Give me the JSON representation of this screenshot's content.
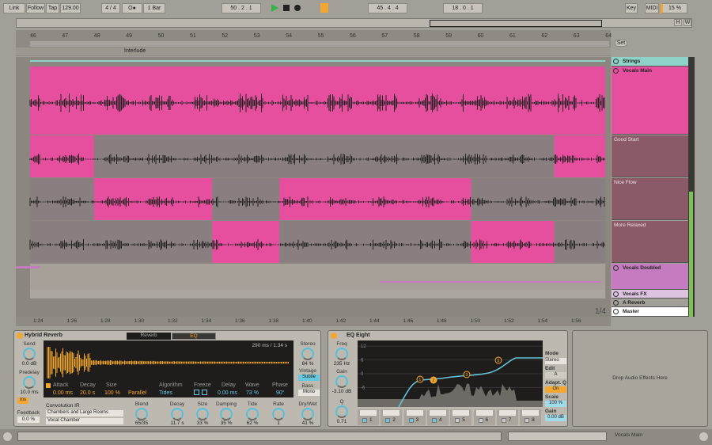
{
  "toolbar": {
    "link": "Link",
    "follow": "Follow",
    "tap": "Tap",
    "tempo": "129.00",
    "signature": "4 / 4",
    "quantize": "1 Bar",
    "position": "50 .  2 .  1",
    "loop_start": "45 .  4 .  4",
    "loop_length": "18 .  0 .  1",
    "key": "Key",
    "midi": "MIDI",
    "cpu": "15 %",
    "metronome": "O●"
  },
  "overview": {
    "h": "H",
    "w": "W"
  },
  "ruler": {
    "bars": [
      "46",
      "47",
      "48",
      "49",
      "50",
      "51",
      "52",
      "53",
      "54",
      "55",
      "56",
      "57",
      "58",
      "59",
      "60",
      "61",
      "62",
      "63",
      "64"
    ],
    "locator": "Interlude",
    "set": "Set"
  },
  "time_ruler": {
    "labels": [
      "1:24",
      "1:26",
      "1:28",
      "1:30",
      "1:32",
      "1:34",
      "1:36",
      "1:38",
      "1:40",
      "1:42",
      "1:44",
      "1:46",
      "1:48",
      "1:50",
      "1:52",
      "1:54",
      "1:56"
    ],
    "zoom": "1/4"
  },
  "tracks": [
    {
      "name": "Strings",
      "color": "#8fd3c8"
    },
    {
      "name": "Vocals Main",
      "color": "#e54f9e"
    },
    {
      "name": "Good Start",
      "color": "#8a5a68"
    },
    {
      "name": "Nice Flow",
      "color": "#8a5a68"
    },
    {
      "name": "More Relaxed",
      "color": "#8a5a68"
    },
    {
      "name": "Vocals Doubled",
      "color": "#c57bbf"
    },
    {
      "name": "Vocals FX",
      "color": "#dcc3e0"
    },
    {
      "name": "A Reverb",
      "color": "#a29e98"
    },
    {
      "name": "Master",
      "color": "#ffffff"
    }
  ],
  "takes": [
    {
      "pink": [
        [
          46,
          48
        ],
        [
          62.4,
          64
        ]
      ]
    },
    {
      "pink": [
        [
          48,
          51.7
        ],
        [
          53.8,
          59.8
        ]
      ]
    },
    {
      "pink": [
        [
          51.7,
          53.8
        ],
        [
          59.8,
          62.4
        ]
      ]
    }
  ],
  "reverb": {
    "title": "Hybrid Reverb",
    "tab_reverb": "Reverb",
    "tab_eq": "EQ",
    "send_label": "Send",
    "send": "0.0 dB",
    "predelay_label": "Predelay",
    "predelay": "10.0 ms",
    "ms": "ms",
    "feedback_label": "Feedback",
    "feedback": "0.0 %",
    "time_readout": "290 ms / 1.34 s",
    "attack_label": "Attack",
    "attack": "0.00 ms",
    "decay_label": "Decay",
    "decay": "20.0 s",
    "size_label": "Size",
    "size": "100 %",
    "routing": "Parallel",
    "algorithm_label": "Algorithm",
    "algorithm": "Tides",
    "freeze_label": "Freeze",
    "delay_label": "Delay",
    "delay": "0.00 ms",
    "wave_label": "Wave",
    "wave": "73 %",
    "phase_label": "Phase",
    "phase": "90°",
    "ir_label": "Convolution IR",
    "ir_category": "Chambers and Large Rooms",
    "ir": "Vocal Chamber",
    "blend_label": "Blend",
    "blend": "65/35",
    "k_decay_label": "Decay",
    "k_decay": "11.7 s",
    "k_size_label": "Size",
    "k_size": "33 %",
    "damping_label": "Damping",
    "damping": "35 %",
    "tide_label": "Tide",
    "tide": "62 %",
    "rate_label": "Rate",
    "rate": "1",
    "stereo_label": "Stereo",
    "stereo": "84 %",
    "vintage_label": "Vintage",
    "vintage": "Subtle",
    "bass_label": "Bass",
    "bass": "Mono",
    "drywet_label": "Dry/Wet",
    "drywet": "41 %"
  },
  "eq": {
    "title": "EQ Eight",
    "freq_label": "Freq",
    "freq": "235 Hz",
    "gain_label": "Gain",
    "gain": "-3.10 dB",
    "q_label": "Q",
    "q": "0.71",
    "db_ticks": [
      "12",
      "6",
      "0",
      "-6",
      "-12"
    ],
    "freq_ticks": [
      "100",
      "1k",
      "10k"
    ],
    "mode_label": "Mode",
    "mode": "Stereo",
    "edit_label": "Edit",
    "edit": "A",
    "adaptq_label": "Adapt. Q",
    "adaptq": "On",
    "scale_label": "Scale",
    "scale": "100 %",
    "outgain_label": "Gain",
    "outgain": "0.00 dB",
    "bands": [
      "1",
      "2",
      "3",
      "4",
      "5",
      "6",
      "7",
      "8"
    ],
    "bands_on": [
      true,
      true,
      true,
      true,
      false,
      false,
      false,
      false
    ],
    "nodes": [
      "1",
      "2",
      "3",
      "5"
    ]
  },
  "drop_zone": "Drop Audio Effects Here",
  "status": {
    "track": "Vocals Main"
  },
  "colors": {
    "pink": "#e54f9e",
    "take_gray": "#8a7f80",
    "accent": "#f3a730",
    "cyan": "#67c7dc"
  }
}
